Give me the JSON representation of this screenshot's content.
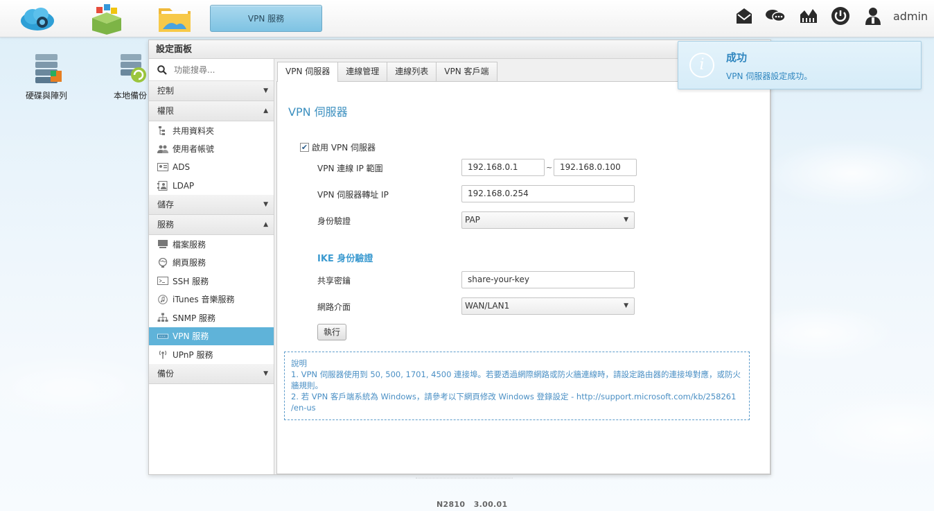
{
  "topbar": {
    "task_label": "VPN 服務",
    "user": "admin"
  },
  "desktop": {
    "icons": [
      {
        "label": "硬碟與陣列"
      },
      {
        "label": "本地備份"
      }
    ]
  },
  "panel": {
    "title": "設定面板",
    "search_placeholder": "功能搜尋...",
    "sections": [
      {
        "label": "控制",
        "expanded": false
      },
      {
        "label": "權限",
        "expanded": true,
        "items": [
          "共用資料夾",
          "使用者帳號",
          "ADS",
          "LDAP"
        ]
      },
      {
        "label": "儲存",
        "expanded": false
      },
      {
        "label": "服務",
        "expanded": true,
        "items": [
          "檔案服務",
          "網頁服務",
          "SSH 服務",
          "iTunes 音樂服務",
          "SNMP 服務",
          "VPN 服務",
          "UPnP 服務"
        ]
      },
      {
        "label": "備份",
        "expanded": false
      }
    ],
    "active_item": "VPN 服務"
  },
  "tabs": [
    "VPN 伺服器",
    "連線管理",
    "連線列表",
    "VPN 客戶端"
  ],
  "form": {
    "title": "VPN 伺服器",
    "enable_label": "啟用 VPN 伺服器",
    "enabled": true,
    "ip_range_label": "VPN 連線 IP 範圍",
    "ip_start": "192.168.0.1",
    "ip_end": "192.168.0.100",
    "tilde": "~",
    "server_ip_label": "VPN 伺服器轉址 IP",
    "server_ip": "192.168.0.254",
    "auth_label": "身份驗證",
    "auth_value": "PAP",
    "ike_title": "IKE 身份驗證",
    "psk_label": "共享密鑰",
    "psk_value": "share-your-key",
    "iface_label": "網路介面",
    "iface_value": "WAN/LAN1",
    "exec_label": "執行"
  },
  "notes": {
    "heading": "說明",
    "line1": "1. VPN 伺服器使用到 50, 500, 1701, 4500 連接埠。若要透過網際網路或防火牆連線時，請設定路由器的連接埠對應，或防火牆規則。",
    "line2": "2. 若 VPN 客戶端系統為 Windows，請參考以下網頁修改 Windows 登錄設定 - http://support.microsoft.com/kb/258261 /en-us"
  },
  "toast": {
    "title": "成功",
    "message": "VPN 伺服器設定成功。"
  },
  "footer": {
    "version": "N2810   3.00.01"
  },
  "colors": {
    "accent": "#5fb3d9",
    "link_blue": "#3b8fbf",
    "toast_bg": "#d6ecf8"
  }
}
